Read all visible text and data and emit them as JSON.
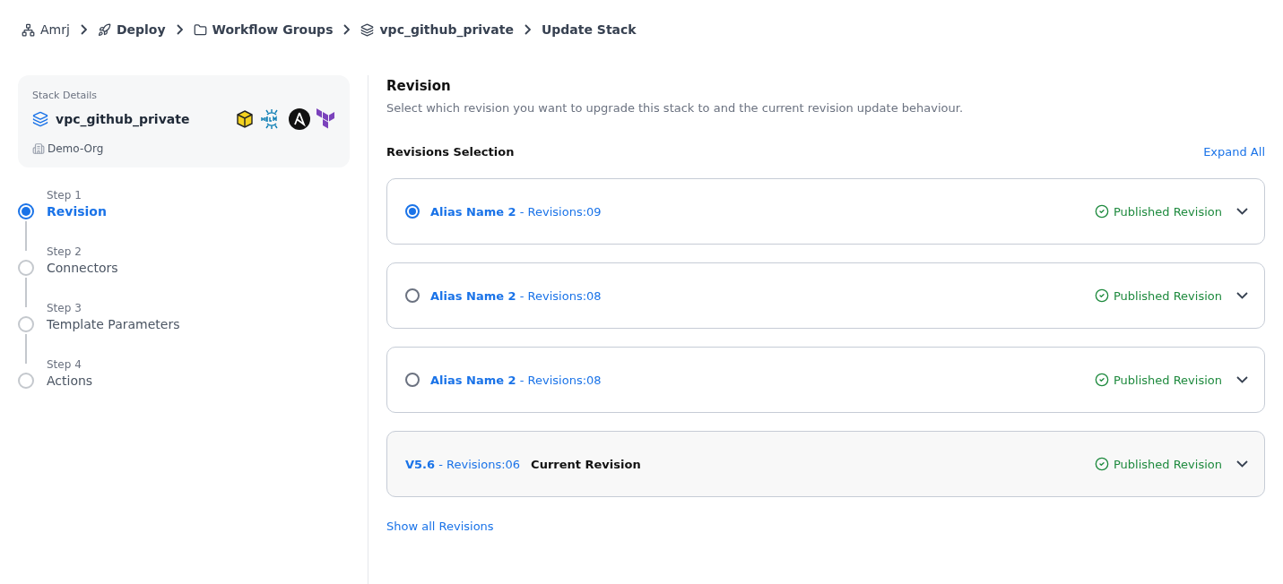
{
  "breadcrumbs": [
    "Amrj",
    "Deploy",
    "Workflow Groups",
    "vpc_github_private",
    "Update Stack"
  ],
  "stack": {
    "caption": "Stack Details",
    "name": "vpc_github_private",
    "org": "Demo-Org"
  },
  "steps": [
    {
      "step": "Step 1",
      "label": "Revision",
      "selected": true
    },
    {
      "step": "Step 2",
      "label": "Connectors",
      "selected": false
    },
    {
      "step": "Step 3",
      "label": "Template Parameters",
      "selected": false
    },
    {
      "step": "Step 4",
      "label": "Actions",
      "selected": false
    }
  ],
  "section": {
    "title": "Revision",
    "description": "Select which revision you want to upgrade this stack to and the current revision update behaviour."
  },
  "selection": {
    "title": "Revisions Selection",
    "expand_all": "Expand All"
  },
  "revisions": [
    {
      "kind": "selectable",
      "name": "Alias Name 2",
      "revision": "- Revisions:09",
      "status": "Published Revision",
      "selected": true
    },
    {
      "kind": "selectable",
      "name": "Alias Name 2",
      "revision": "- Revisions:08",
      "status": "Published Revision",
      "selected": false
    },
    {
      "kind": "selectable",
      "name": "Alias Name 2",
      "revision": "- Revisions:08",
      "status": "Published Revision",
      "selected": false
    },
    {
      "kind": "current",
      "name": "V5.6",
      "revision": "- Revisions:06",
      "tag": "Current Revision",
      "status": "Published Revision"
    }
  ],
  "show_all": "Show all Revisions"
}
